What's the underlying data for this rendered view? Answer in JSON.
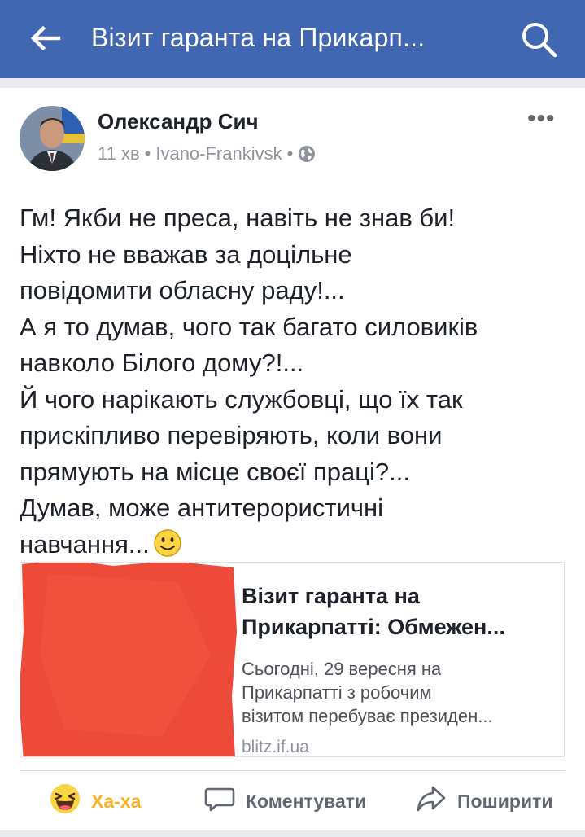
{
  "header": {
    "title": "Візит гаранта на Прикарп...",
    "back_icon": "arrow-left-icon",
    "search_icon": "search-icon",
    "bar_color": "#4267b2"
  },
  "post": {
    "author": "Олександр Сич",
    "time": "11 хв",
    "location": "Ivano-Frankivsk",
    "separator": "•",
    "privacy_icon": "globe-icon",
    "more_label": "•••",
    "text_lines": [
      "Гм! Якби не преса, навіть не знав би!",
      "Ніхто не вважав за доцільне",
      "повідомити обласну раду!...",
      "А я то думав, чого так багато силовиків",
      "навколо Білого дому?!...",
      "Й чого нарікають службовці, що їх так",
      "прискіпливо перевіряють, коли вони",
      "прямують на місце своєї праці?...",
      "Думав, може антитерористичні",
      "навчання..."
    ],
    "emoji": "slightly-smiling-face-icon"
  },
  "link_preview": {
    "title_lines": [
      "Візит гаранта на",
      "Прикарпатті: Обмежен..."
    ],
    "description_lines": [
      "Сьогодні, 29 вересня на",
      "Прикарпатті з робочим",
      "візитом перебуває президен..."
    ],
    "domain": "blitz.if.ua",
    "thumbnail_color": "#ee4a3a"
  },
  "actions": {
    "haha_label": "Ха-ха",
    "comment_label": "Коментувати",
    "share_label": "Поширити",
    "haha_color": "#f7b125"
  }
}
